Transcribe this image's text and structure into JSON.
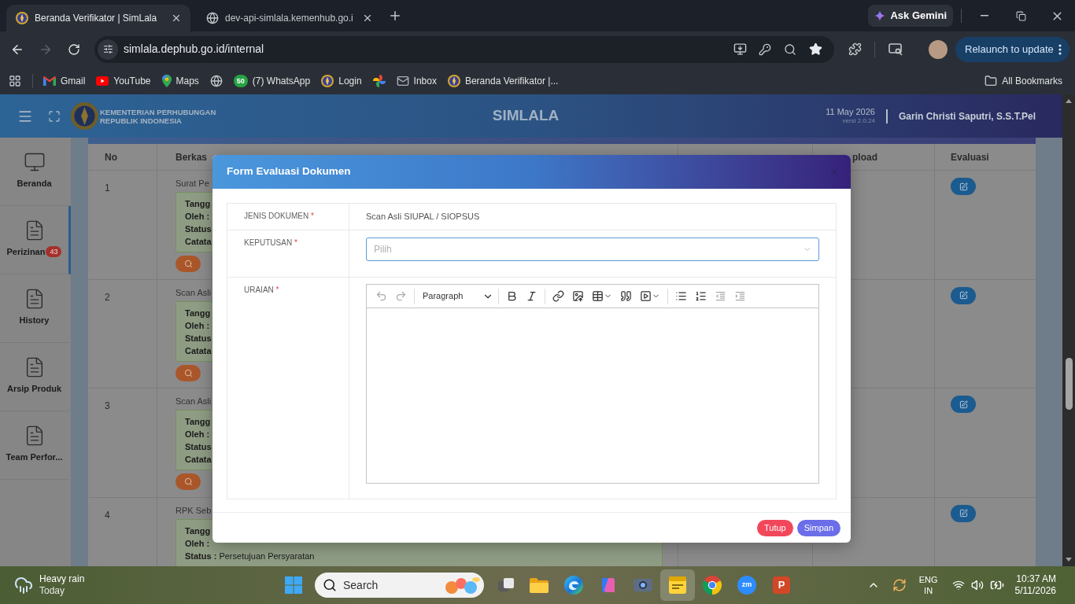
{
  "browser": {
    "tabs": [
      {
        "title": "Beranda Verifikator | SimLala",
        "kind": "emblem",
        "selected": true
      },
      {
        "title": "dev-api-simlala.kemenhub.go.i",
        "kind": "globe",
        "selected": false
      }
    ],
    "gemini_button": "Ask Gemini",
    "forward_disabled": true,
    "url": "simlala.dephub.go.id/internal",
    "bookmarked": true,
    "relaunch_button": "Relaunch to update",
    "bookmarks": [
      {
        "kind": "gmail",
        "label": "Gmail"
      },
      {
        "kind": "youtube",
        "label": "YouTube"
      },
      {
        "kind": "maps",
        "label": "Maps"
      },
      {
        "kind": "globe"
      },
      {
        "kind": "whatsapp",
        "badge": "50",
        "label": "(7) WhatsApp"
      },
      {
        "kind": "emblem",
        "label": "Login"
      },
      {
        "kind": "photos"
      },
      {
        "kind": "mail",
        "label": "Inbox"
      },
      {
        "kind": "emblem",
        "label": "Beranda Verifikator |..."
      }
    ],
    "all_bookmarks": "All Bookmarks"
  },
  "header": {
    "org": [
      "KEMENTERIAN PERHUBUNGAN",
      "REPUBLIK INDONESIA"
    ],
    "title": "SIMLALA",
    "date": "11 May 2026",
    "version": "versi 2.0.24",
    "user": "Garin Christi Saputri, S.S.T.Pel"
  },
  "sidebar": {
    "items": [
      {
        "kind": "monitor",
        "label": "Beranda",
        "selected": false
      },
      {
        "kind": "document",
        "label": "Perizinan",
        "badge": "43",
        "selected": true
      },
      {
        "kind": "document",
        "label": "History",
        "selected": false
      },
      {
        "kind": "document",
        "label": "Arsip Produk",
        "selected": false
      },
      {
        "kind": "document",
        "label": "Team Perfor...",
        "selected": false
      }
    ]
  },
  "table": {
    "columns": [
      "No",
      "Berkas",
      "pload",
      "Evaluasi"
    ],
    "rows": [
      {
        "no": "1",
        "file": "Surat Pe",
        "details": [
          {
            "label": "Tangg"
          },
          {
            "label": "Oleh :"
          },
          {
            "label": "Status"
          },
          {
            "label": "Catata"
          }
        ],
        "search_button": true
      },
      {
        "no": "2",
        "file": "Scan Asli",
        "details": [
          {
            "label": "Tangg"
          },
          {
            "label": "Oleh :"
          },
          {
            "label": "Status"
          },
          {
            "label": "Catata"
          }
        ],
        "search_button": true
      },
      {
        "no": "3",
        "file": "Scan Asli",
        "details": [
          {
            "label": "Tangg"
          },
          {
            "label": "Oleh :"
          },
          {
            "label": "Status"
          },
          {
            "label": "Catata"
          }
        ],
        "search_button": true
      },
      {
        "no": "4",
        "file": "RPK Seb",
        "details": [
          {
            "label": "Tangg"
          },
          {
            "label": "Oleh :"
          },
          {
            "label": "Status :",
            "value": "Persetujuan Persyaratan"
          }
        ],
        "search_button": false
      }
    ]
  },
  "modal": {
    "title": "Form Evaluasi Dokumen",
    "fields": [
      {
        "kind": "text",
        "label": "JENIS DOKUMEN",
        "required_mark": "*",
        "value": "Scan Asli SIUPAL / SIOPSUS"
      },
      {
        "kind": "select",
        "label": "KEPUTUSAN",
        "required_mark": "*",
        "placeholder": "Pilih",
        "focused": true
      },
      {
        "kind": "editor",
        "label": "URAIAN",
        "required_mark": "*",
        "toolbar": [
          [
            {
              "kind": "undo",
              "disabled": true
            },
            {
              "kind": "redo",
              "disabled": true
            }
          ],
          [
            {
              "kind": "heading",
              "label": "Paragraph",
              "dropdown": true,
              "disabled": false
            }
          ],
          [
            {
              "kind": "bold",
              "disabled": false
            },
            {
              "kind": "italic",
              "disabled": false
            }
          ],
          [
            {
              "kind": "link",
              "disabled": false
            },
            {
              "kind": "image",
              "disabled": false
            },
            {
              "kind": "table",
              "dropdown": true,
              "disabled": false
            },
            {
              "kind": "quote",
              "disabled": false
            },
            {
              "kind": "media",
              "dropdown": true,
              "disabled": false
            }
          ],
          [
            {
              "kind": "bulleted-list",
              "disabled": false
            },
            {
              "kind": "numbered-list",
              "disabled": false
            },
            {
              "kind": "outdent",
              "disabled": true
            },
            {
              "kind": "indent",
              "disabled": true
            }
          ]
        ]
      }
    ],
    "buttons": [
      {
        "label": "Tutup",
        "kind": "danger"
      },
      {
        "label": "Simpan",
        "kind": "primary"
      }
    ]
  },
  "taskbar": {
    "weather": {
      "condition": "Heavy rain",
      "day": "Today"
    },
    "search": {
      "placeholder": "Search"
    },
    "apps": [
      {
        "kind": "task-view",
        "selected": false
      },
      {
        "kind": "file-explorer",
        "selected": false
      },
      {
        "kind": "edge",
        "selected": false
      },
      {
        "kind": "copilot",
        "selected": false
      },
      {
        "kind": "camera",
        "selected": false
      },
      {
        "kind": "sticky-notes",
        "selected": true
      },
      {
        "kind": "chrome",
        "selected": false
      },
      {
        "kind": "zoom",
        "label": "zm",
        "selected": false
      },
      {
        "kind": "powerpoint",
        "label": "P",
        "selected": false
      }
    ],
    "language": "ENG",
    "region": "IN",
    "time": "10:37 AM",
    "date": "5/11/2026"
  }
}
